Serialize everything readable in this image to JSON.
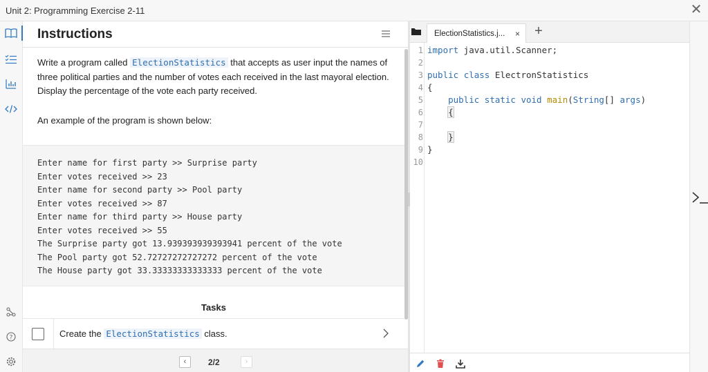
{
  "window": {
    "title": "Unit 2: Programming Exercise 2-11"
  },
  "rail": {
    "items": [
      "book-icon",
      "checklist-icon",
      "chart-icon",
      "code-icon"
    ],
    "bottom_items": [
      "share-icon",
      "help-icon",
      "settings-icon"
    ]
  },
  "instructions": {
    "heading": "Instructions",
    "desc_part1": "Write a program called ",
    "desc_code": "ElectionStatistics",
    "desc_part2": " that accepts as user input the names of three political parties and the number of votes each received in the last mayoral election. Display the percentage of the vote each party received.",
    "example_label": "An example of the program is shown below:",
    "example_lines": [
      "Enter name for first party >> Surprise party",
      "Enter votes received >> 23",
      "Enter name for second party >> Pool party",
      "Enter votes received >> 87",
      "Enter name for third party >> House party",
      "Enter votes received >> 55",
      "The Surprise party got 13.939393939393941 percent of the vote",
      "The Pool party got 52.72727272727272 percent of the vote",
      "The House party got 33.33333333333333 percent of the vote"
    ],
    "tasks_title": "Tasks",
    "task": {
      "part1": "Create the ",
      "code": "ElectionStatistics",
      "part2": " class."
    },
    "pager": {
      "prev": "‹",
      "next": "›",
      "label": "2/2"
    }
  },
  "editor": {
    "tab_name": "ElectionStatistics.j...",
    "tab_close": "×",
    "add_tab": "+",
    "lines": [
      "1",
      "2",
      "3",
      "4",
      "5",
      "6",
      "7",
      "8",
      "9",
      "10"
    ],
    "code": {
      "l1_kw": "import",
      "l1_rest": " java.util.Scanner;",
      "l3_kw1": "public",
      "l3_kw2": "class",
      "l3_name": "ElectronStatistics",
      "l4": "{",
      "l5_kw1": "public",
      "l5_kw2": "static",
      "l5_kw3": "void",
      "l5_fn": "main",
      "l5_open": "(",
      "l5_type": "String",
      "l5_arr": "[] ",
      "l5_arg": "args",
      "l5_close": ")",
      "l6": "{",
      "l8": "}",
      "l9": "}"
    }
  },
  "colors": {
    "accent": "#2f78c4",
    "code_inline": "#2f6fb0",
    "delete": "#e05050"
  }
}
